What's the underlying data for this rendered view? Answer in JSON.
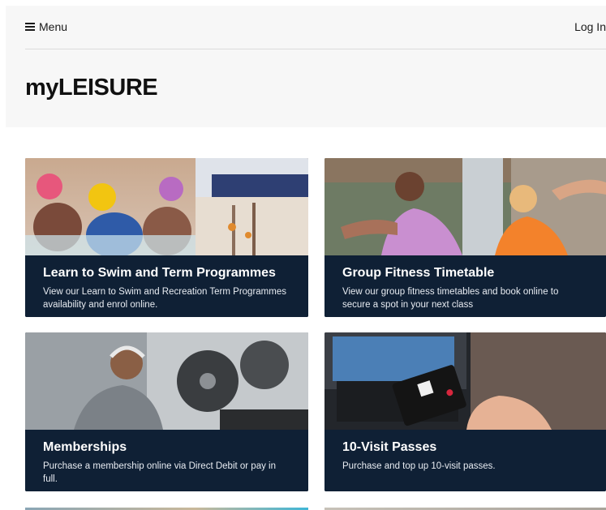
{
  "header": {
    "menu_label": "Menu",
    "login_label": "Log In",
    "site_title": "myLEISURE"
  },
  "cards": [
    {
      "title": "Learn to Swim and Term Programmes",
      "description": "View our Learn to Swim and Recreation Term Programmes availability and enrol online."
    },
    {
      "title": "Group Fitness Timetable",
      "description": "View our group fitness timetables and book online to secure a spot in your next class"
    },
    {
      "title": "Memberships",
      "description": "Purchase a membership online via Direct Debit or pay in full."
    },
    {
      "title": "10-Visit Passes",
      "description": "Purchase and top up 10-visit passes."
    }
  ],
  "icons": {
    "menu": "hamburger-icon"
  },
  "colors": {
    "card_caption_bg": "#0f2035",
    "header_bg": "#f7f7f7"
  }
}
